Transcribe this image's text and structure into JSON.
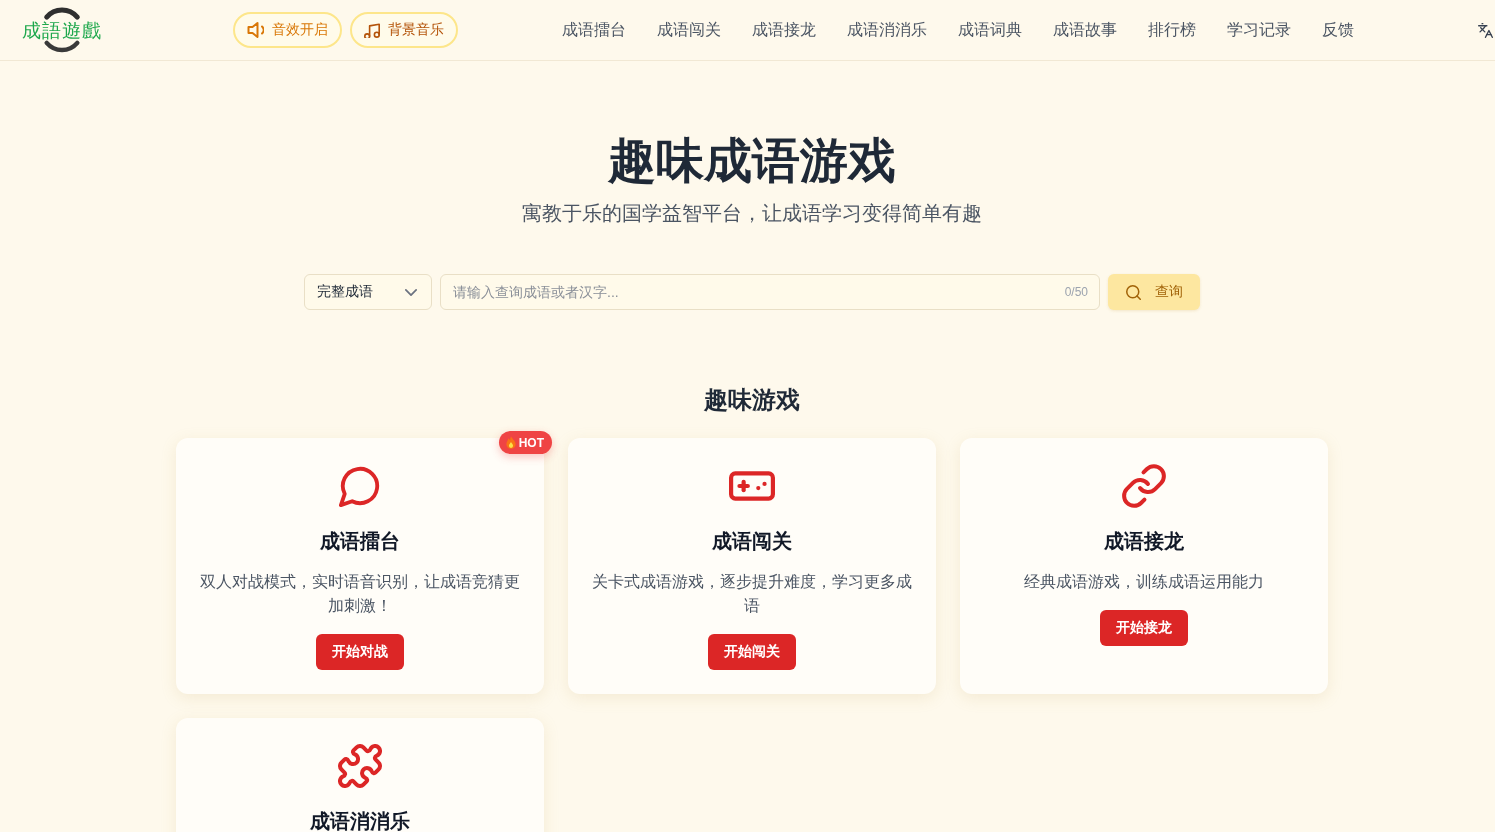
{
  "header": {
    "logo": {
      "text": "成語遊戲"
    },
    "toggles": [
      {
        "kind": "sound",
        "label": "音效开启",
        "on": true
      },
      {
        "kind": "music",
        "label": "背景音乐",
        "on": false
      }
    ],
    "nav": [
      "成语擂台",
      "成语闯关",
      "成语接龙",
      "成语消消乐",
      "成语词典",
      "成语故事",
      "排行榜",
      "学习记录",
      "反馈"
    ]
  },
  "hero": {
    "title": "趣味成语游戏",
    "subtitle": "寓教于乐的国学益智平台，让成语学习变得简单有趣"
  },
  "search": {
    "mode": "完整成语",
    "placeholder": "请输入查询成语或者汉字...",
    "counter": "0/50",
    "button": {
      "label": "查询",
      "disabled": true
    }
  },
  "games": {
    "title": "趣味游戏",
    "cards": [
      {
        "kind": "battle",
        "title": "成语擂台",
        "description": "双人对战模式，实时语音识别，让成语竞猜更加刺激！",
        "button": "开始对战",
        "badge": "HOT"
      },
      {
        "kind": "levels",
        "title": "成语闯关",
        "description": "关卡式成语游戏，逐步提升难度，学习更多成语",
        "button": "开始闯关"
      },
      {
        "kind": "chain",
        "title": "成语接龙",
        "description": "经典成语游戏，训练成语运用能力",
        "button": "开始接龙"
      },
      {
        "kind": "match",
        "title": "成语消消乐"
      }
    ]
  }
}
